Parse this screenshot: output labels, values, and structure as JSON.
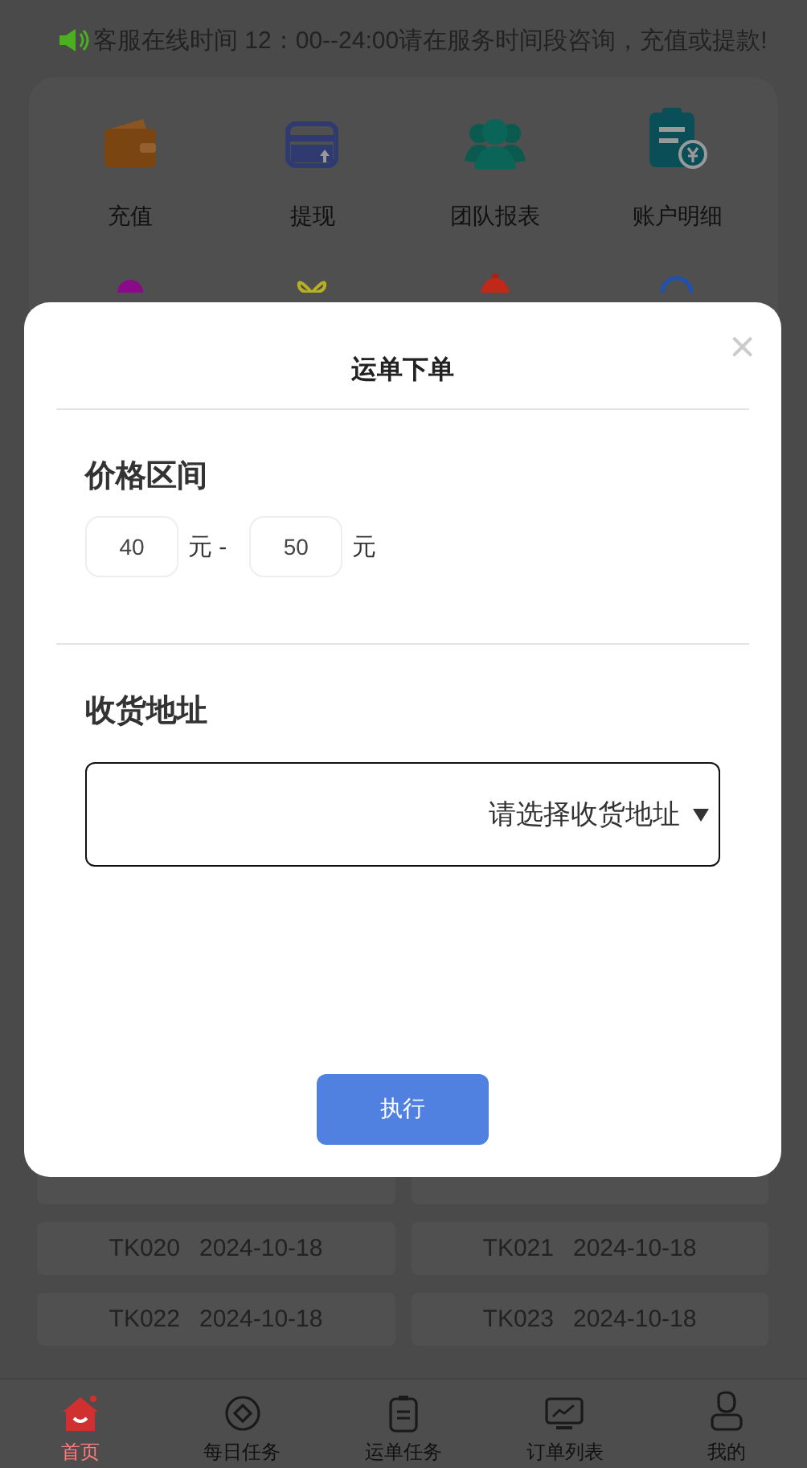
{
  "notice": {
    "text": "客服在线时间 12：00--24:00请在服务时间段咨询，充值或提款!"
  },
  "shortcuts": [
    {
      "label": "充值"
    },
    {
      "label": "提现"
    },
    {
      "label": "团队报表"
    },
    {
      "label": "账户明细"
    }
  ],
  "tasks": [
    {
      "code": "TK020",
      "date": "2024-10-18"
    },
    {
      "code": "TK021",
      "date": "2024-10-18"
    },
    {
      "code": "TK022",
      "date": "2024-10-18"
    },
    {
      "code": "TK023",
      "date": "2024-10-18"
    }
  ],
  "tab_bar": [
    {
      "label": "首页",
      "selected": true
    },
    {
      "label": "每日任务",
      "selected": false
    },
    {
      "label": "运单任务",
      "selected": false
    },
    {
      "label": "订单列表",
      "selected": false
    },
    {
      "label": "我的",
      "selected": false
    }
  ],
  "dialog": {
    "title": "运单下单",
    "close": "×",
    "price_range": {
      "label": "价格区间",
      "min": "40",
      "separator": "元 -",
      "max": "50",
      "unit": "元"
    },
    "address": {
      "label": "收货地址",
      "placeholder": "请选择收货地址"
    },
    "submit": "执行"
  }
}
